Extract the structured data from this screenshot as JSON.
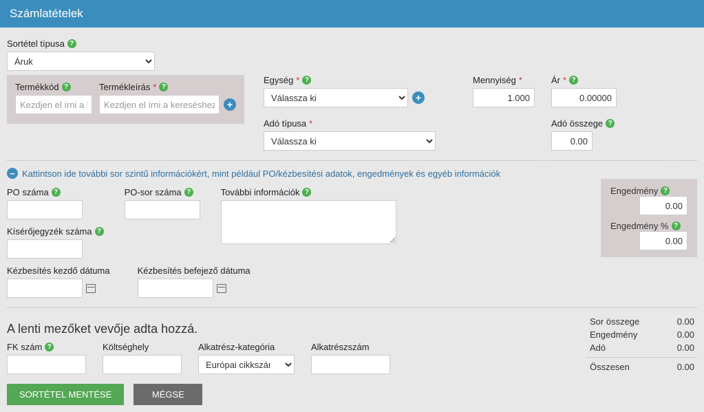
{
  "header": {
    "title": "Számlatételek"
  },
  "sortetel": {
    "label": "Sortétel típusa",
    "value": "Áruk"
  },
  "product": {
    "code_label": "Termékkód",
    "code_placeholder": "Kezdjen el írni a ke",
    "desc_label": "Termékleírás",
    "desc_placeholder": "Kezdjen el írni a kereséshez"
  },
  "unit": {
    "label": "Egység",
    "value": "Válassza ki"
  },
  "qty": {
    "label": "Mennyiség",
    "value": "1.000"
  },
  "price": {
    "label": "Ár",
    "value": "0.00000"
  },
  "tax_type": {
    "label": "Adó típusa",
    "value": "Válassza ki"
  },
  "tax_amount": {
    "label": "Adó összege",
    "value": "0.00"
  },
  "toggle": {
    "text": "Kattintson ide további sor szintű információkért, mint például PO/kézbesítési adatok, engedmények és egyéb információk"
  },
  "extra": {
    "po_label": "PO száma",
    "po_line_label": "PO-sor száma",
    "more_info_label": "További információk",
    "dispatch_label": "Kísérőjegyzék száma",
    "delivery_start_label": "Kézbesítés kezdő dátuma",
    "delivery_end_label": "Kézbesítés befejező dátuma"
  },
  "discount": {
    "amount_label": "Engedmény",
    "amount_value": "0.00",
    "percent_label": "Engedmény %",
    "percent_value": "0.00"
  },
  "buyer": {
    "heading": "A lenti mezőket vevője adta hozzá.",
    "fk_label": "FK szám",
    "koltseghely_label": "Költséghely",
    "alkatresz_kat_label": "Alkatrész-kategória",
    "alkatresz_kat_value": "Európai cikkszám",
    "alkatresz_szam_label": "Alkatrészszám"
  },
  "totals": {
    "line_label": "Sor összege",
    "line_value": "0.00",
    "disc_label": "Engedmény",
    "disc_value": "0.00",
    "tax_label": "Adó",
    "tax_value": "0.00",
    "total_label": "Összesen",
    "total_value": "0.00"
  },
  "buttons": {
    "save": "SORTÉTEL MENTÉSE",
    "cancel": "MÉGSE"
  }
}
